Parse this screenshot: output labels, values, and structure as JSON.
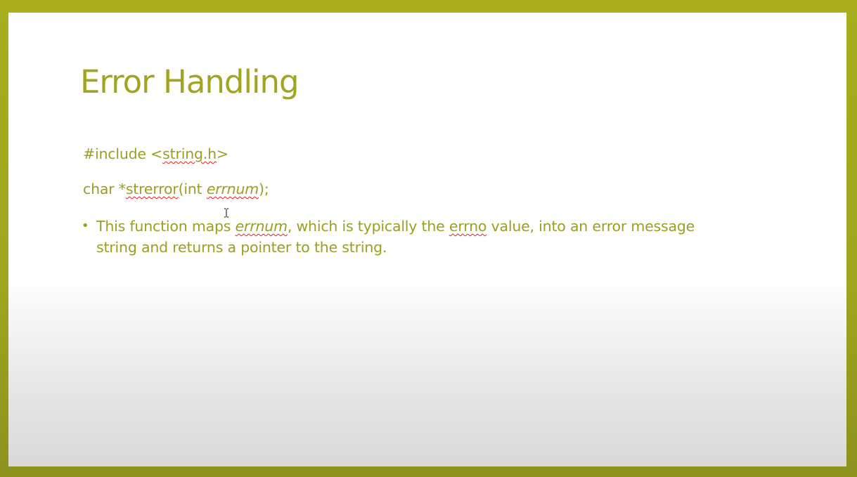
{
  "slide": {
    "title": "Error Handling",
    "include_line": {
      "prefix": "#include <",
      "header": "string.h",
      "suffix": ">"
    },
    "prototype_line": {
      "prefix": "char *",
      "func_name": "strerror",
      "mid": "(int ",
      "param": "errnum",
      "suffix": ");"
    },
    "bullet": {
      "marker": "•",
      "part1": "This function maps ",
      "param": "errnum",
      "part2": ", which is typically the ",
      "errno": "errno",
      "part3": " value, into an error message string and returns a pointer to the string."
    }
  },
  "colors": {
    "frame": "#a8ae1e",
    "title": "#a2a522",
    "body_text": "#9c9e21",
    "spellcheck": "#e02020"
  },
  "icons": {
    "cursor": "text-cursor-icon"
  }
}
